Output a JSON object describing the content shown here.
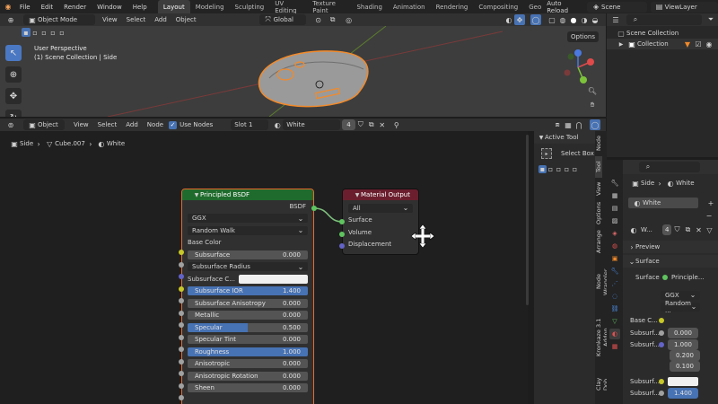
{
  "menubar": {
    "items": [
      "File",
      "Edit",
      "Render",
      "Window",
      "Help"
    ],
    "workspaces": [
      "Layout",
      "Modeling",
      "Sculpting",
      "UV Editing",
      "Texture Paint",
      "Shading",
      "Animation",
      "Rendering",
      "Compositing",
      "Geo"
    ],
    "active_workspace": "Layout",
    "auto_reload": "Auto Reload",
    "scene": "Scene",
    "view_layer": "ViewLayer"
  },
  "viewport": {
    "mode": "Object Mode",
    "menus": [
      "View",
      "Select",
      "Add",
      "Object"
    ],
    "orientation": "Global",
    "options": "Options",
    "info_line1": "User Perspective",
    "info_line2": "(1) Scene Collection | Side"
  },
  "outliner": {
    "root": "Scene Collection",
    "child": "Collection"
  },
  "node_editor": {
    "type": "Object",
    "menus": [
      "View",
      "Select",
      "Add",
      "Node"
    ],
    "use_nodes": "Use Nodes",
    "slot": "Slot 1",
    "material": "White",
    "users": "4",
    "breadcrumb": [
      "Side",
      "Cube.007",
      "White"
    ]
  },
  "bsdf_node": {
    "title": "Principled BSDF",
    "output": "BSDF",
    "distribution": "GGX",
    "subsurface_method": "Random Walk",
    "base_color_label": "Base Color",
    "rows": [
      {
        "label": "Subsurface",
        "value": "0.000"
      },
      {
        "label": "Subsurface Radius",
        "value": ""
      },
      {
        "label": "Subsurface C...",
        "value": ""
      },
      {
        "label": "Subsurface IOR",
        "value": "1.400"
      },
      {
        "label": "Subsurface Anisotropy",
        "value": "0.000"
      },
      {
        "label": "Metallic",
        "value": "0.000"
      },
      {
        "label": "Specular",
        "value": "0.500"
      },
      {
        "label": "Specular Tint",
        "value": "0.000"
      },
      {
        "label": "Roughness",
        "value": "1.000"
      },
      {
        "label": "Anisotropic",
        "value": "0.000"
      },
      {
        "label": "Anisotropic Rotation",
        "value": "0.000"
      },
      {
        "label": "Sheen",
        "value": "0.000"
      }
    ]
  },
  "output_node": {
    "title": "Material Output",
    "target": "All",
    "inputs": [
      "Surface",
      "Volume",
      "Displacement"
    ]
  },
  "npanel": {
    "section": "Active Tool",
    "tool": "Select Box",
    "tabs": [
      "Node",
      "Tool",
      "View",
      "Options",
      "Arrange",
      "Node Wrangler",
      "Kronkaze 3.1 Addon",
      "Clay Doh"
    ]
  },
  "properties": {
    "crumb_object": "Side",
    "crumb_material": "White",
    "slot_material": "White",
    "material_short": "W...",
    "users": "4",
    "preview": "Preview",
    "surface_section": "Surface",
    "surface_label": "Surface",
    "surface_value": "Principle...",
    "distribution": "GGX",
    "method": "Random ...",
    "base_color": "Base C...",
    "subsurf1": "Subsurf...",
    "subsurf1_value": "0.000",
    "subsurf2": "Subsurf...",
    "radius": [
      "1.000",
      "0.200",
      "0.100"
    ],
    "subsurf3": "Subsurf...",
    "subsurf4": "Subsurf...",
    "subsurf4_value": "1.400"
  },
  "colors": {
    "accent": "#4772b3",
    "selection": "#e86a2a",
    "bsdf_header": "#1f6b2d",
    "output_header": "#6b1f2e"
  }
}
